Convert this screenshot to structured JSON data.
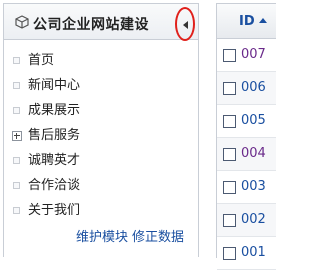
{
  "panel": {
    "title": "公司企业网站建设",
    "collapse_icon": "collapse-left-arrow",
    "annotation_color": "#e0201b",
    "items": [
      {
        "label": "首页",
        "icon": "node"
      },
      {
        "label": "新闻中心",
        "icon": "node"
      },
      {
        "label": "成果展示",
        "icon": "node"
      },
      {
        "label": "售后服务",
        "icon": "expand-plus"
      },
      {
        "label": "诚聘英才",
        "icon": "node"
      },
      {
        "label": "合作洽谈",
        "icon": "node"
      },
      {
        "label": "关于我们",
        "icon": "node"
      }
    ],
    "footer": {
      "maintain_label": "维护模块",
      "fix_label": "修正数据"
    }
  },
  "grid": {
    "column": "ID",
    "sort": "ascending",
    "rows": [
      {
        "id": "007",
        "color": "#6a2a8a"
      },
      {
        "id": "006",
        "color": "#1a4fa0"
      },
      {
        "id": "005",
        "color": "#1a4fa0"
      },
      {
        "id": "004",
        "color": "#6a2a8a"
      },
      {
        "id": "003",
        "color": "#1a4fa0"
      },
      {
        "id": "002",
        "color": "#1a4fa0"
      },
      {
        "id": "001",
        "color": "#1a4fa0"
      }
    ]
  }
}
